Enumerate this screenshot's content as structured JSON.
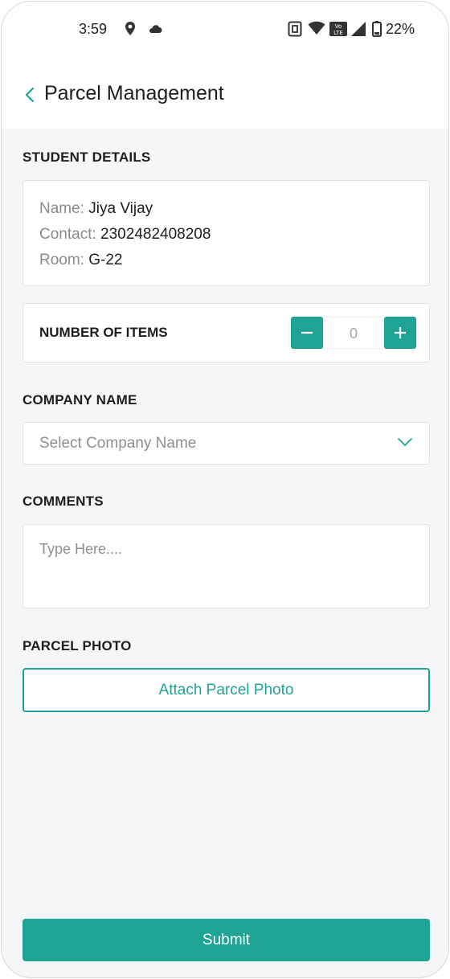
{
  "status_bar": {
    "time": "3:59",
    "battery": "22%",
    "icons": [
      "location-pin-icon",
      "cloud-icon",
      "nfc-icon",
      "wifi-icon",
      "volte-icon",
      "signal-icon",
      "battery-icon"
    ]
  },
  "header": {
    "title": "Parcel Management",
    "back_icon": "chevron-left-icon"
  },
  "student_details": {
    "section_label": "STUDENT DETAILS",
    "name_label": "Name:",
    "name_value": "Jiya Vijay",
    "contact_label": "Contact:",
    "contact_value": "2302482408208",
    "room_label": "Room:",
    "room_value": "G-22"
  },
  "items": {
    "label": "NUMBER OF ITEMS",
    "value": "0",
    "decrement_icon": "minus-icon",
    "increment_icon": "plus-icon"
  },
  "company": {
    "section_label": "COMPANY NAME",
    "placeholder": "Select Company Name",
    "dropdown_icon": "chevron-down-icon"
  },
  "comments": {
    "section_label": "COMMENTS",
    "placeholder": "Type Here...."
  },
  "parcel_photo": {
    "section_label": "PARCEL PHOTO",
    "button_label": "Attach Parcel Photo"
  },
  "submit": {
    "label": "Submit"
  },
  "colors": {
    "accent": "#1fa394",
    "background": "#f4f6f7",
    "card": "#ffffff"
  }
}
